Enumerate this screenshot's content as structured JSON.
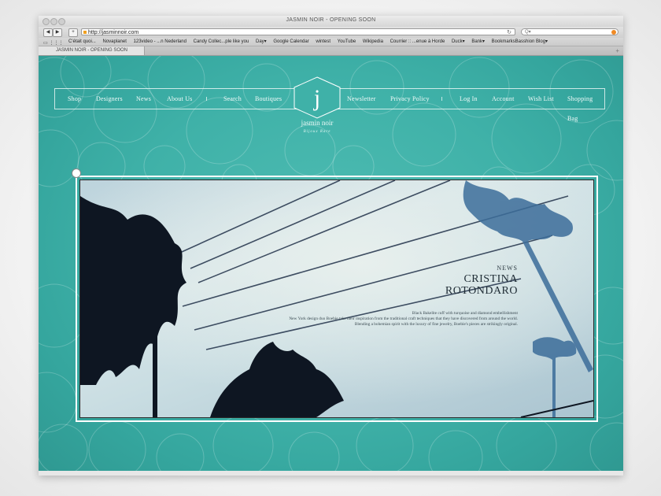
{
  "browser": {
    "window_title": "JASMIN NOIR - OPENING SOON",
    "url": "http://jasminnoir.com",
    "search_placeholder": "Q▾",
    "back_label": "◀",
    "forward_label": "▶",
    "add_label": "+",
    "reload_label": "↻",
    "bookmark_icons": "▭ ⋮⋮⋮",
    "bookmarks": [
      "C'était quoi...",
      "Novaplanet",
      "123video - ...n Nederland",
      "Candy Collec...ple like you",
      "Day▾",
      "Google Calendar",
      "wintest",
      "YouTube",
      "Wikipedia",
      "Courrier :: ...enue à Horde",
      "Duck▾",
      "Bank▾",
      "BookmarksBasshion Blog▾"
    ],
    "tab_label": "JASMIN NOIR - OPENING SOON",
    "tab_add": "+"
  },
  "site": {
    "nav_left": [
      "Shop",
      "Designers",
      "News",
      "About Us",
      "Search",
      "Boutiques"
    ],
    "nav_right": [
      "Newsletter",
      "Privacy Policy",
      "Log In",
      "Account",
      "Wish List",
      "Shopping Bag"
    ],
    "logo_letter": "j",
    "logo_name": "jasmin noir",
    "logo_tagline": "Bijoux Rare"
  },
  "hero": {
    "section": "NEWS",
    "title_line1": "CRISTINA",
    "title_line2": "ROTONDARO",
    "desc_line1": "Black Bakelite cuff with turquoise and diamond embellishment",
    "desc_line2": "New York design duo Boebie take their inspiration from the traditional craft techniques that they have discovered from around the world.",
    "desc_line3": "Blending a bohemian spirit with the luxury of fine jewelry, Boebie's pieces are strikingly original."
  },
  "colors": {
    "page_teal": "#3fb1a8",
    "nav_text": "#f3fbfa"
  }
}
